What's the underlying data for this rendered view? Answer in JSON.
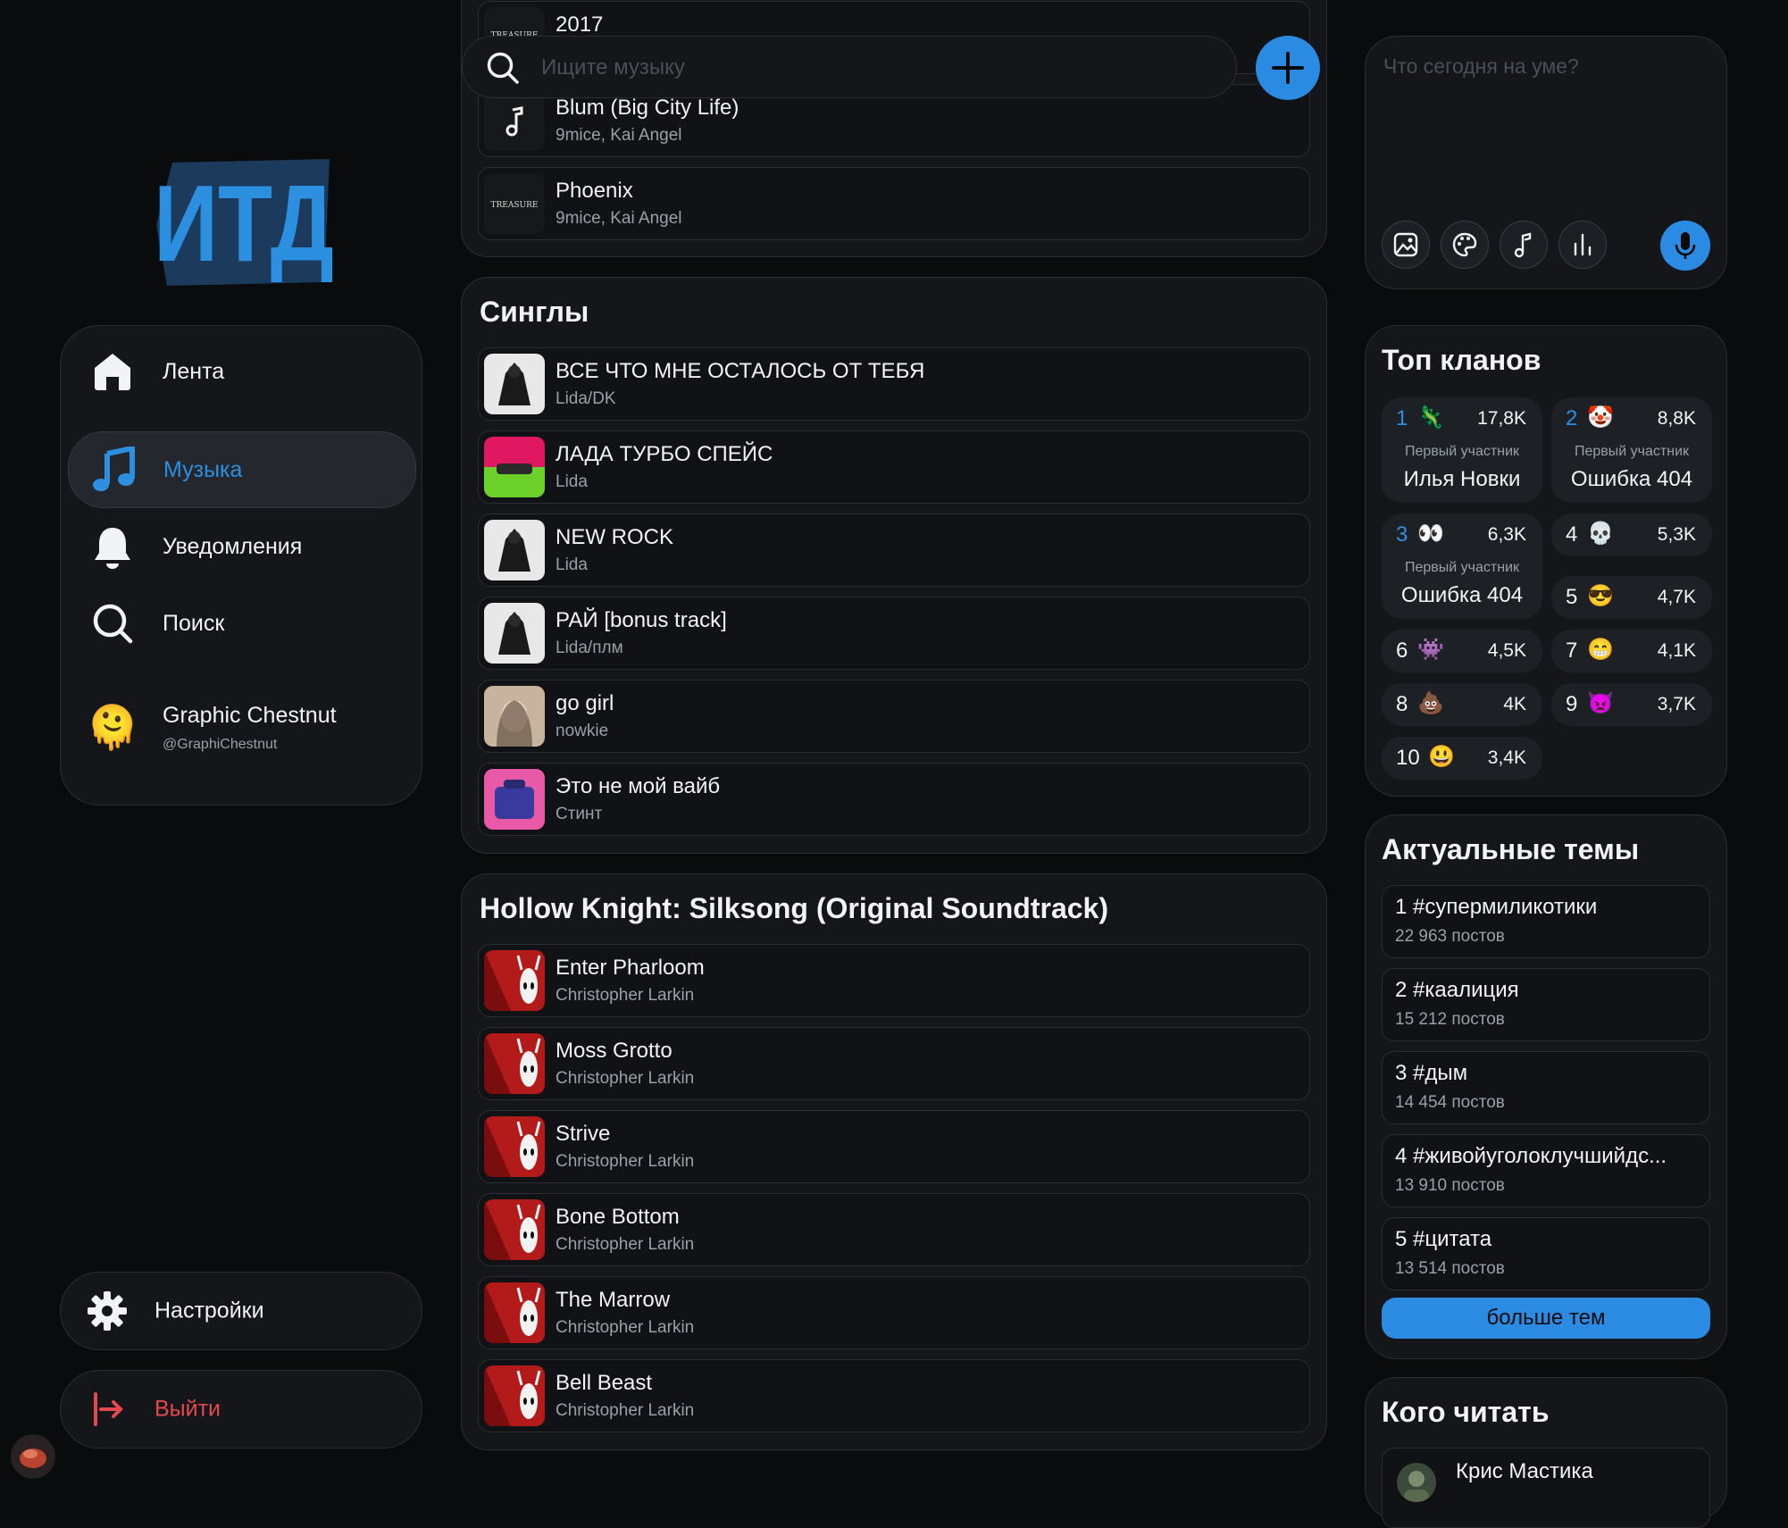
{
  "logo": {
    "text": "ИТД"
  },
  "nav": {
    "items": [
      {
        "label": "Лента",
        "icon": "home-icon"
      },
      {
        "label": "Музыка",
        "icon": "music-note-icon",
        "active": true
      },
      {
        "label": "Уведомления",
        "icon": "bell-icon"
      },
      {
        "label": "Поиск",
        "icon": "search-icon"
      }
    ],
    "profile": {
      "name": "Graphic Chestnut",
      "handle": "@GraphiChestnut",
      "avatar": "🫠"
    },
    "settings_label": "Настройки",
    "exit_label": "Выйти"
  },
  "search": {
    "placeholder": "Ищите музыку"
  },
  "album_top": {
    "tracks": [
      {
        "title": "2017",
        "artist": ""
      },
      {
        "title": "Blum (Big City Life)",
        "artist": "9mice, Kai Angel"
      },
      {
        "title": "Phoenix",
        "artist": "9mice, Kai Angel"
      }
    ]
  },
  "singles": {
    "title": "Синглы",
    "tracks": [
      {
        "title": "ВСЕ ЧТО МНЕ ОСТАЛОСЬ ОТ ТЕБЯ",
        "artist": "Lida/DK"
      },
      {
        "title": "ЛАДА ТУРБО СПЕЙС",
        "artist": "Lida"
      },
      {
        "title": "NEW ROCK",
        "artist": "Lida"
      },
      {
        "title": "РАЙ [bonus track]",
        "artist": "Lida/плм"
      },
      {
        "title": "go girl",
        "artist": "nowkie"
      },
      {
        "title": "Это не мой вайб",
        "artist": "Стинт"
      }
    ]
  },
  "soundtrack": {
    "title": "Hollow Knight: Silksong (Original Soundtrack)",
    "tracks": [
      {
        "title": "Enter Pharloom",
        "artist": "Christopher Larkin"
      },
      {
        "title": "Moss Grotto",
        "artist": "Christopher Larkin"
      },
      {
        "title": "Strive",
        "artist": "Christopher Larkin"
      },
      {
        "title": "Bone Bottom",
        "artist": "Christopher Larkin"
      },
      {
        "title": "The Marrow",
        "artist": "Christopher Larkin"
      },
      {
        "title": "Bell Beast",
        "artist": "Christopher Larkin"
      }
    ]
  },
  "composer": {
    "placeholder": "Что сегодня на уме?"
  },
  "clans": {
    "title": "Топ кланов",
    "first_member_label": "Первый участник",
    "items": [
      {
        "rank": "1",
        "emoji": "🦎",
        "score": "17,8K",
        "member": "Илья Новки"
      },
      {
        "rank": "2",
        "emoji": "🤡",
        "score": "8,8K",
        "member": "Ошибка 404"
      },
      {
        "rank": "3",
        "emoji": "👀",
        "score": "6,3K",
        "member": "Ошибка 404"
      },
      {
        "rank": "4",
        "emoji": "💀",
        "score": "5,3K"
      },
      {
        "rank": "5",
        "emoji": "😎",
        "score": "4,7K"
      },
      {
        "rank": "6",
        "emoji": "👾",
        "score": "4,5K"
      },
      {
        "rank": "7",
        "emoji": "😁",
        "score": "4,1K"
      },
      {
        "rank": "8",
        "emoji": "💩",
        "score": "4K"
      },
      {
        "rank": "9",
        "emoji": "👿",
        "score": "3,7K"
      },
      {
        "rank": "10",
        "emoji": "😃",
        "score": "3,4K"
      }
    ]
  },
  "topics": {
    "title": "Актуальные темы",
    "items": [
      {
        "tag": "1 #супермиликотики",
        "count": "22 963 постов"
      },
      {
        "tag": "2 #каалиция",
        "count": "15 212 постов"
      },
      {
        "tag": "3 #дым",
        "count": "14 454 постов"
      },
      {
        "tag": "4 #живойуголоклучшийдс...",
        "count": "13 910 постов"
      },
      {
        "tag": "5 #цитата",
        "count": "13 514 постов"
      }
    ],
    "more_label": "больше тем"
  },
  "follow": {
    "title": "Кого читать",
    "items": [
      {
        "name": "Крис Мастика"
      }
    ]
  },
  "colors": {
    "accent": "#2b8be3",
    "danger": "#e5484d",
    "background": "#0a0b0d",
    "card": "#141619"
  }
}
